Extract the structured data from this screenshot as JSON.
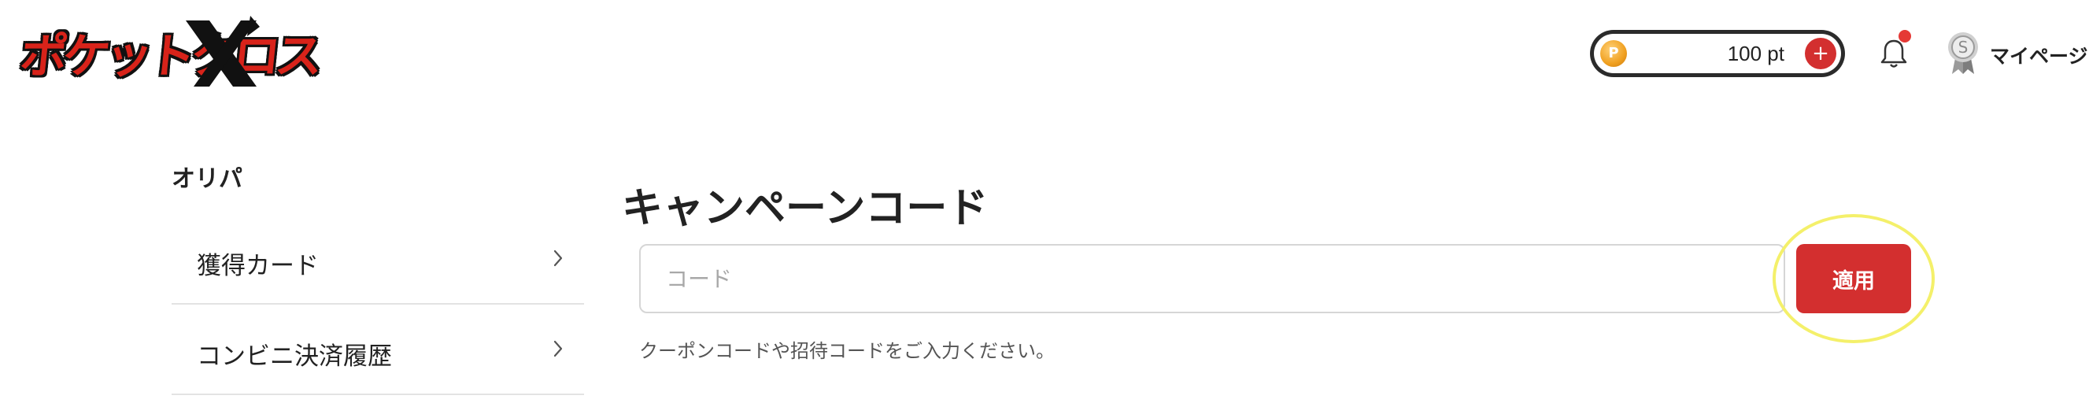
{
  "header": {
    "logo_text": "ポケットクロス",
    "points": {
      "value": "100 pt",
      "coin_symbol": "P",
      "add_symbol": "+"
    },
    "notification_dot": true,
    "mypage": {
      "label": "マイページ",
      "avatar_letter": "S"
    }
  },
  "sidebar": {
    "heading": "オリパ",
    "items": [
      {
        "label": "獲得カード"
      },
      {
        "label": "コンビニ決済履歴"
      }
    ]
  },
  "main": {
    "title": "キャンペーンコード",
    "code_input": {
      "placeholder": "コード",
      "value": ""
    },
    "apply_label": "適用",
    "help_text": "クーポンコードや招待コードをご入力ください。"
  },
  "colors": {
    "accent": "#d32f2f",
    "pill_border": "#2b2b2b",
    "highlight": "#f4f06a",
    "divider": "#e3e3e3"
  }
}
